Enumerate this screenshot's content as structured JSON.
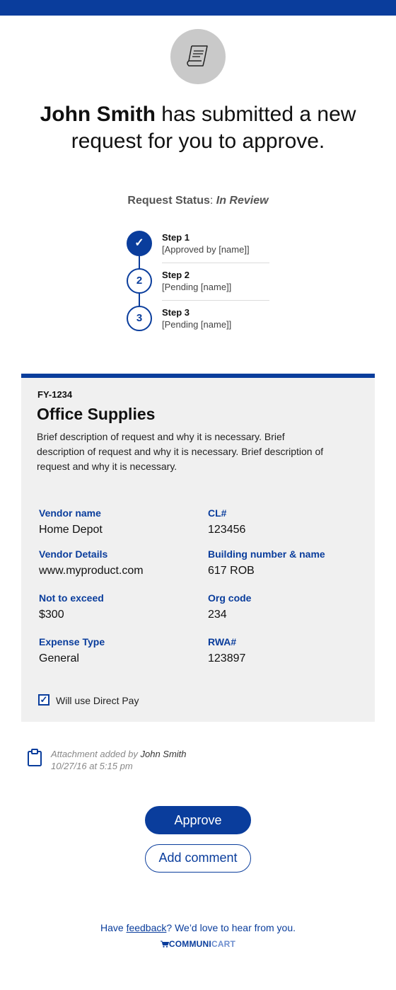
{
  "colors": {
    "brand_blue": "#0a3d9c",
    "panel_gray": "#f0f0f0",
    "icon_circle": "#c9c9c9"
  },
  "header": {
    "icon": "receipt-icon",
    "requester_name": "John Smith",
    "headline_rest": " has submitted a new request for you to approve."
  },
  "status": {
    "label": "Request Status",
    "separator": ": ",
    "value": "In Review"
  },
  "steps": [
    {
      "number": "1",
      "state": "approved",
      "icon": "check-icon",
      "title": "Step 1",
      "detail": "[Approved by [name]]"
    },
    {
      "number": "2",
      "state": "pending",
      "title": "Step 2",
      "detail": "[Pending [name]]"
    },
    {
      "number": "3",
      "state": "pending",
      "title": "Step 3",
      "detail": "[Pending [name]]"
    }
  ],
  "request": {
    "code": "FY-1234",
    "title": "Office Supplies",
    "description": "Brief description of request and why it is necessary. Brief description of request and why it is necessary. Brief description of request and why it is necessary.",
    "fields": {
      "vendor_name": {
        "label": "Vendor name",
        "value": "Home Depot"
      },
      "cl": {
        "label": "CL#",
        "value": "123456"
      },
      "vendor_details": {
        "label": "Vendor Details",
        "value": "www.myproduct.com"
      },
      "building": {
        "label": "Building number & name",
        "value": "617 ROB"
      },
      "not_to_exceed": {
        "label": "Not to exceed",
        "value": "$300"
      },
      "org_code": {
        "label": "Org code",
        "value": "234"
      },
      "expense_type": {
        "label": "Expense Type",
        "value": "General"
      },
      "rwa": {
        "label": "RWA#",
        "value": "123897"
      }
    },
    "direct_pay": {
      "checked": true,
      "label": "Will use Direct Pay"
    }
  },
  "attachment": {
    "icon": "clipboard-icon",
    "text": "Attachment added by ",
    "author": "John Smith",
    "timestamp": "10/27/16 at 5:15 pm"
  },
  "actions": {
    "approve": "Approve",
    "comment": "Add comment"
  },
  "footer": {
    "feedback_prefix": "Have ",
    "feedback_link": "feedback",
    "feedback_suffix": "? We’d love to hear from you.",
    "brand_icon": "cart-icon",
    "brand_bold": "COMMUNI",
    "brand_light": "CART"
  }
}
